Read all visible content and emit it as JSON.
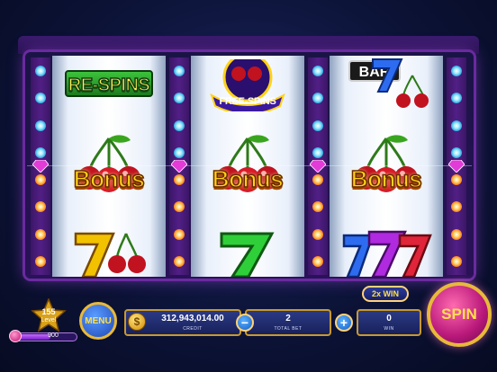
{
  "reels": [
    {
      "top": "RE-SPINS",
      "middle": "Bonus"
    },
    {
      "top": "FREE-SPINS",
      "middle": "Bonus"
    },
    {
      "top": "BAR",
      "middle": "Bonus"
    }
  ],
  "level": {
    "number": "155",
    "label": "Level",
    "progress_value": "900"
  },
  "menu_label": "MENU",
  "credit": {
    "value": "312,943,014.00",
    "label": "CREDIT"
  },
  "bet": {
    "value": "2",
    "label": "TOTAL BET",
    "minus": "−",
    "plus": "+"
  },
  "win": {
    "value": "0",
    "label": "WIN",
    "multiplier": "2x WIN"
  },
  "spin_label": "SPIN",
  "colors": {
    "gold": "#c89a2c",
    "panel": "#1f2a6e",
    "spin": "#b8187a"
  }
}
